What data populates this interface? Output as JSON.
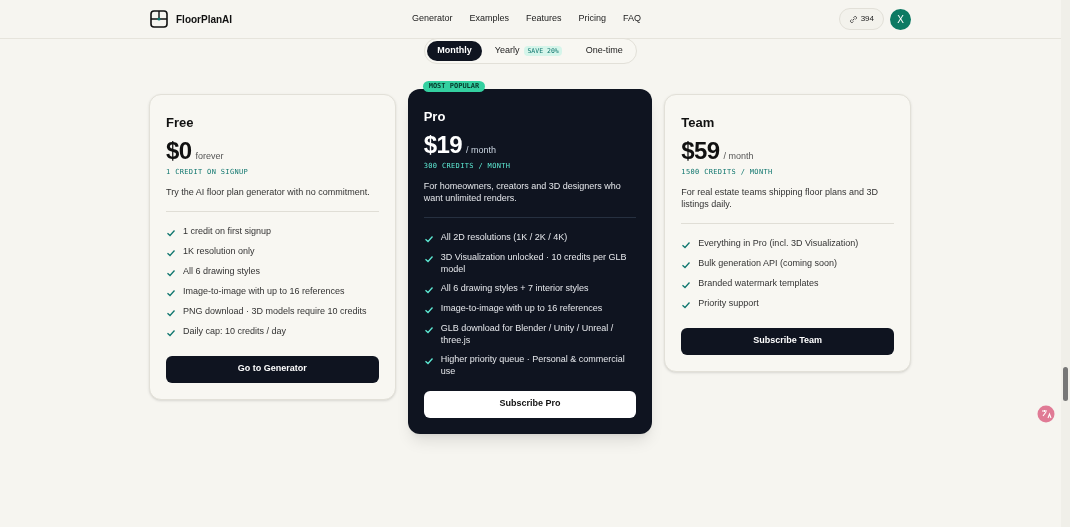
{
  "header": {
    "brand": "FloorPlanAI",
    "nav": [
      "Generator",
      "Examples",
      "Features",
      "Pricing",
      "FAQ"
    ],
    "credits": "394",
    "avatar": "X"
  },
  "billing": [
    {
      "label": "Monthly",
      "selected": true
    },
    {
      "label": "Yearly",
      "badge": "SAVE 20%",
      "selected": false
    },
    {
      "label": "One-time",
      "selected": false
    }
  ],
  "plans": [
    {
      "name": "Free",
      "price": "$0",
      "period": "forever",
      "credits": "1 CREDIT ON SIGNUP",
      "description": "Try the AI floor plan generator with no commitment.",
      "features": [
        "1 credit on first signup",
        "1K resolution only",
        "All 6 drawing styles",
        "Image-to-image with up to 16 references",
        "PNG download · 3D models require 10 credits",
        "Daily cap: 10 credits / day"
      ],
      "button": "Go to Generator",
      "highlighted": false
    },
    {
      "name": "Pro",
      "badge": "MOST POPULAR",
      "price": "$19",
      "period": "/ month",
      "credits": "300 CREDITS / MONTH",
      "description": "For homeowners, creators and 3D designers who want unlimited renders.",
      "features": [
        "All 2D resolutions (1K / 2K / 4K)",
        "3D Visualization unlocked · 10 credits per GLB model",
        "All 6 drawing styles + 7 interior styles",
        "Image-to-image with up to 16 references",
        "GLB download for Blender / Unity / Unreal / three.js",
        "Higher priority queue · Personal & commercial use"
      ],
      "button": "Subscribe Pro",
      "highlighted": true
    },
    {
      "name": "Team",
      "price": "$59",
      "period": "/ month",
      "credits": "1500 CREDITS / MONTH",
      "description": "For real estate teams shipping floor plans and 3D listings daily.",
      "features": [
        "Everything in Pro (incl. 3D Visualization)",
        "Bulk generation API (coming soon)",
        "Branded watermark templates",
        "Priority support"
      ],
      "button": "Subscribe Team",
      "highlighted": false
    }
  ]
}
